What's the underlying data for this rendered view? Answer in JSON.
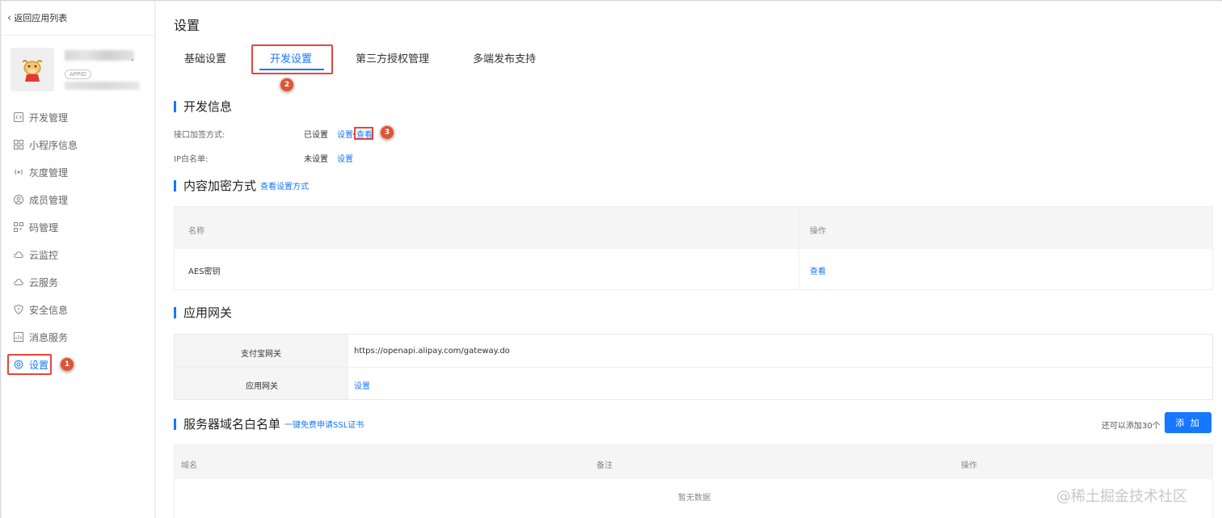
{
  "sidebar": {
    "back_label": "返回应用列表",
    "app_id_badge": "APPID",
    "app_name_suffix": ".",
    "menu": [
      {
        "label": "开发管理",
        "icon": "code-icon"
      },
      {
        "label": "小程序信息",
        "icon": "grid-icon"
      },
      {
        "label": "灰度管理",
        "icon": "broadcast-icon"
      },
      {
        "label": "成员管理",
        "icon": "user-circle-icon"
      },
      {
        "label": "码管理",
        "icon": "qrcode-icon"
      },
      {
        "label": "云监控",
        "icon": "cloud-icon"
      },
      {
        "label": "云服务",
        "icon": "cloud-icon"
      },
      {
        "label": "安全信息",
        "icon": "shield-icon"
      },
      {
        "label": "消息服务",
        "icon": "chart-icon"
      },
      {
        "label": "设置",
        "icon": "gear-icon",
        "active": true
      }
    ]
  },
  "main": {
    "title": "设置",
    "tabs": [
      "基础设置",
      "开发设置",
      "第三方授权管理",
      "多端发布支持"
    ],
    "active_tab": 1
  },
  "dev_info": {
    "title": "开发信息",
    "api_encrypt_label": "接口加签方式:",
    "api_encrypt_value": "已设置",
    "api_encrypt_set": "设置",
    "api_encrypt_sep": "/",
    "api_encrypt_view": "查看",
    "ip_whitelist_label": "IP白名单:",
    "ip_whitelist_value": "未设置",
    "ip_whitelist_set": "设置"
  },
  "content_encrypt": {
    "title": "内容加密方式",
    "link": "查看设置方式",
    "col_name": "名称",
    "col_action": "操作",
    "rows": [
      {
        "name": "AES密钥",
        "action": "查看"
      }
    ]
  },
  "gateway": {
    "title": "应用网关",
    "alipay_label": "支付宝网关",
    "alipay_value": "https://openapi.alipay.com/gateway.do",
    "app_label": "应用网关",
    "app_value": "设置"
  },
  "domain_whitelist": {
    "title": "服务器域名白名单",
    "link": "一键免费申请SSL证书",
    "remain": "还可以添加30个",
    "add_button": "添 加",
    "col_domain": "域名",
    "col_remark": "备注",
    "col_action": "操作",
    "empty": "暂无数据"
  },
  "annotations": [
    "1",
    "2",
    "3"
  ],
  "watermark": "@稀土掘金技术社区",
  "colors": {
    "accent": "#1677ff",
    "highlight": "#e0473d",
    "badge": "#d9563a"
  }
}
